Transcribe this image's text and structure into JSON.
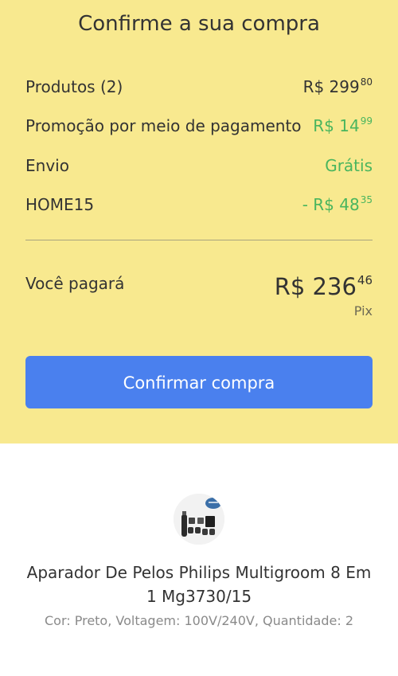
{
  "summary": {
    "title": "Confirme a sua compra",
    "rows": [
      {
        "label": "Produtos (2)",
        "value_main": "R$ 299",
        "value_cents": "80",
        "color": "#333333"
      },
      {
        "label": "Promoção por meio de pagamento",
        "value_main": "R$ 14",
        "value_cents": "99",
        "color": "#49b55e"
      },
      {
        "label": "Envio",
        "value_main": "Grátis",
        "value_cents": "",
        "color": "#49b55e"
      },
      {
        "label": "HOME15",
        "value_main": "- R$ 48",
        "value_cents": "35",
        "color": "#49b55e"
      }
    ],
    "total": {
      "label": "Você pagará",
      "amount_main": "R$ 236",
      "amount_cents": "46",
      "method": "Pix"
    },
    "confirm_label": "Confirmar compra"
  },
  "product": {
    "image_icon": "hair-trimmer-kit-image",
    "name": "Aparador De Pelos Philips Multigroom 8 Em 1 Mg3730/15",
    "attributes": "Cor: Preto, Voltagem: 100V/240V, Quantidade: 2"
  },
  "colors": {
    "background_yellow": "#f8e98f",
    "button_blue": "#4a80ee",
    "discount_green": "#49b55e"
  }
}
